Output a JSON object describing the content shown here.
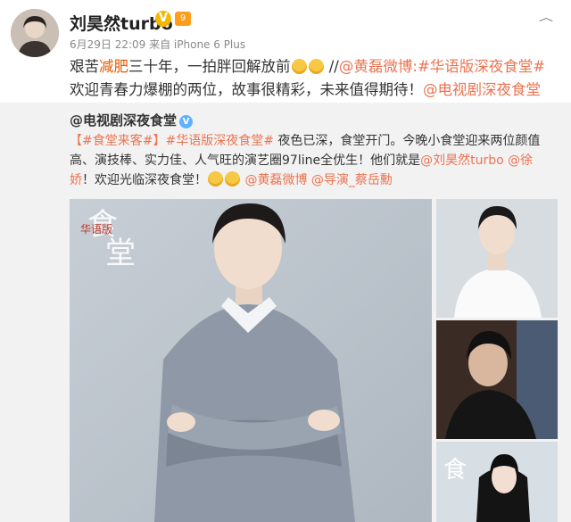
{
  "post": {
    "author": "刘昊然turbo",
    "verified_badge": "V",
    "level_badge": "9",
    "meta": "6月29日 22:09 来自 iPhone 6 Plus",
    "text_before": "艰苦",
    "text_highlight": "减肥",
    "text_after": "三十年，一拍胖回解放前",
    "text_sep": " //",
    "mention1": "@黄磊微博",
    "text_colon": ":",
    "hashtag": "#华语版深夜食堂#",
    "text_mid": " 欢迎青春力爆棚的两位，故事很精彩，未来值得期待！",
    "mention2": "@电视剧深夜食堂"
  },
  "repost": {
    "author": "@电视剧深夜食堂",
    "tag1": "【#食堂来客#】",
    "tag2": "#华语版深夜食堂#",
    "text1": " 夜色已深，食堂开门。今晚小食堂迎来两位颜值高、演技棒、实力佳、人气旺的演艺圈97line全优生！他们就是",
    "mention1": "@刘昊然turbo",
    "mention2": "@徐娇",
    "text2": "！欢迎光临深夜食堂！",
    "mention3": "@黄磊微博",
    "mention4": "@导演_蔡岳勳",
    "poster_text": "华语版"
  },
  "icons": {
    "chevron": "chevron-down-icon",
    "emoji": "crying-emoji-icon"
  },
  "colors": {
    "link": "#eb7350",
    "highlight": "#e25a00",
    "repost_bg": "#f2f2f2"
  }
}
